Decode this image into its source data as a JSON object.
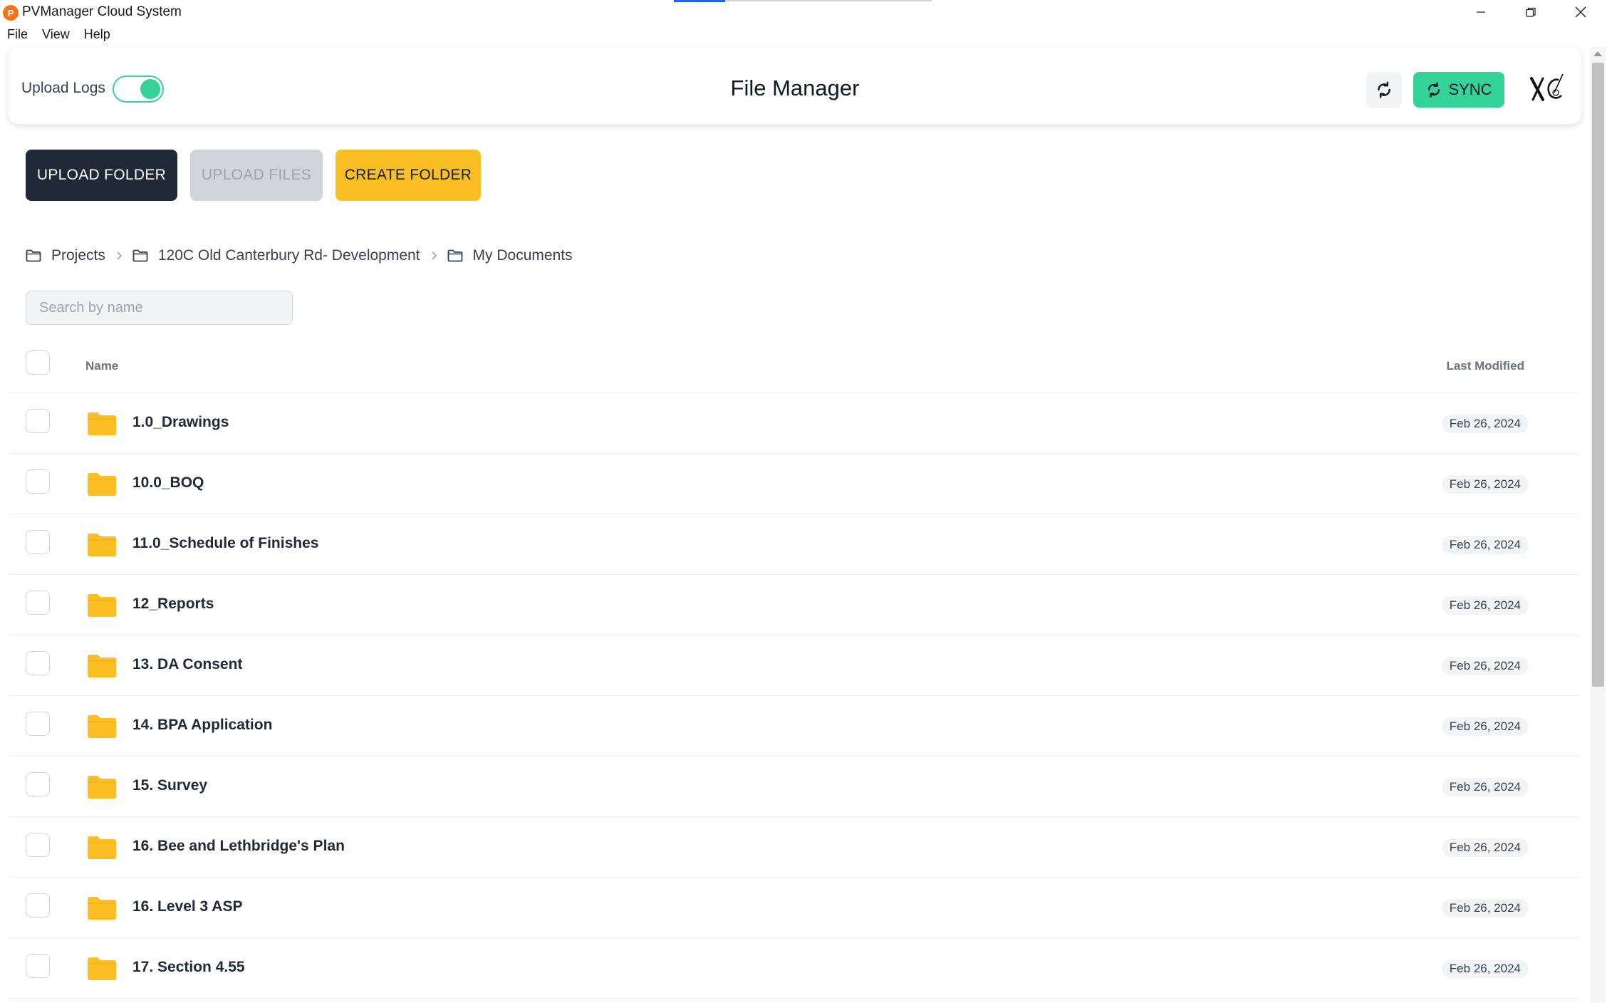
{
  "window": {
    "title": "PVManager Cloud System",
    "logo_glyph": "P",
    "load_progress": 0.2
  },
  "menu": [
    "File",
    "View",
    "Help"
  ],
  "header": {
    "upload_logs_label": "Upload Logs",
    "upload_logs_enabled": true,
    "title": "File Manager",
    "sync_label": "SYNC",
    "accent_color": "#34d399"
  },
  "actions": {
    "upload_folder": "UPLOAD FOLDER",
    "upload_files": "UPLOAD FILES",
    "create_folder": "CREATE FOLDER"
  },
  "breadcrumb": [
    "Projects",
    "120C Old Canterbury Rd- Development",
    "My Documents"
  ],
  "search": {
    "placeholder": "Search by name",
    "value": ""
  },
  "table": {
    "columns": {
      "name": "Name",
      "last_modified": "Last Modified"
    },
    "rows": [
      {
        "name": "1.0_Drawings",
        "modified": "Feb 26, 2024"
      },
      {
        "name": "10.0_BOQ",
        "modified": "Feb 26, 2024"
      },
      {
        "name": "11.0_Schedule of Finishes",
        "modified": "Feb 26, 2024"
      },
      {
        "name": "12_Reports",
        "modified": "Feb 26, 2024"
      },
      {
        "name": "13. DA Consent",
        "modified": "Feb 26, 2024"
      },
      {
        "name": "14. BPA Application",
        "modified": "Feb 26, 2024"
      },
      {
        "name": "15. Survey",
        "modified": "Feb 26, 2024"
      },
      {
        "name": "16. Bee and Lethbridge's Plan",
        "modified": "Feb 26, 2024"
      },
      {
        "name": "16. Level 3 ASP",
        "modified": "Feb 26, 2024"
      },
      {
        "name": "17. Section 4.55",
        "modified": "Feb 26, 2024"
      }
    ]
  }
}
